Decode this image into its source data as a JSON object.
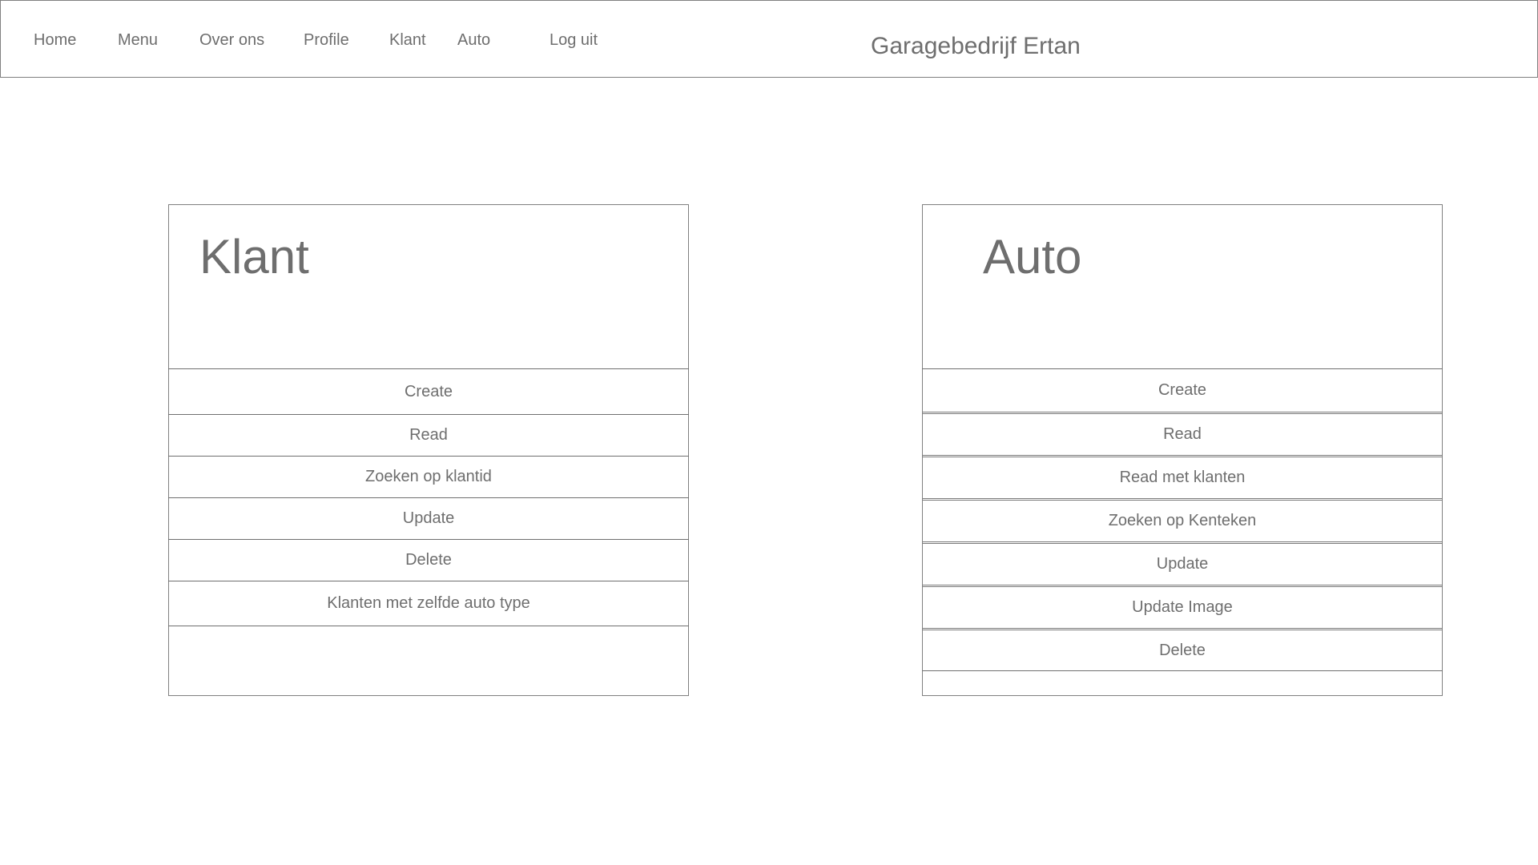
{
  "nav": {
    "items": [
      "Home",
      "Menu",
      "Over ons",
      "Profile",
      "Klant",
      "Auto",
      "Log uit"
    ],
    "brand": "Garagebedrijf Ertan"
  },
  "klant_panel": {
    "title": "Klant",
    "actions": [
      "Create",
      "Read",
      "Zoeken op klantid",
      "Update",
      "Delete",
      "Klanten met zelfde auto type"
    ]
  },
  "auto_panel": {
    "title": "Auto",
    "actions": [
      "Create",
      "Read",
      "Read met klanten",
      "Zoeken op Kenteken",
      "Update",
      "Update Image",
      "Delete"
    ]
  },
  "colors": {
    "text": "#6e6e6e",
    "border": "#808080",
    "background": "#ffffff"
  }
}
